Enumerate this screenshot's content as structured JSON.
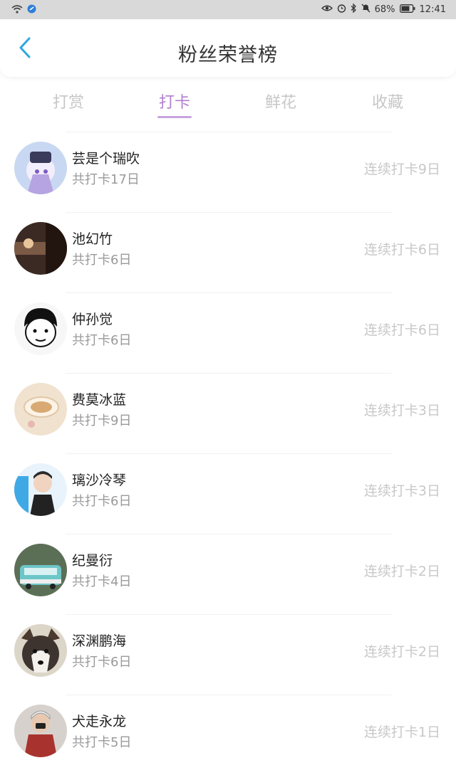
{
  "status_bar": {
    "battery": "68%",
    "time": "12:41",
    "icons": [
      "wifi-icon",
      "app-badge-icon",
      "eye-icon",
      "alarm-icon",
      "bluetooth-icon",
      "mute-icon",
      "battery-icon"
    ]
  },
  "header": {
    "title": "粉丝荣誉榜",
    "back_icon": "chevron-left-icon",
    "accent_color": "#2ea7e0"
  },
  "tabs": [
    {
      "label": "打赏",
      "active": false
    },
    {
      "label": "打卡",
      "active": true
    },
    {
      "label": "鲜花",
      "active": false
    },
    {
      "label": "收藏",
      "active": false
    }
  ],
  "colors": {
    "tab_active": "#b27fd0",
    "tab_inactive": "#c7c7c7"
  },
  "fans": [
    {
      "name": "芸是个瑞吹",
      "total": "共打卡17日",
      "streak": "连续打卡9日"
    },
    {
      "name": "池幻竹",
      "total": "共打卡6日",
      "streak": "连续打卡6日"
    },
    {
      "name": "仲孙觉",
      "total": "共打卡6日",
      "streak": "连续打卡6日"
    },
    {
      "name": "费莫冰蓝",
      "total": "共打卡9日",
      "streak": "连续打卡3日"
    },
    {
      "name": "璃沙冷琴",
      "total": "共打卡6日",
      "streak": "连续打卡3日"
    },
    {
      "name": "纪曼衍",
      "total": "共打卡4日",
      "streak": "连续打卡2日"
    },
    {
      "name": "深渊鹏海",
      "total": "共打卡6日",
      "streak": "连续打卡2日"
    },
    {
      "name": "犬走永龙",
      "total": "共打卡5日",
      "streak": "连续打卡1日"
    }
  ]
}
